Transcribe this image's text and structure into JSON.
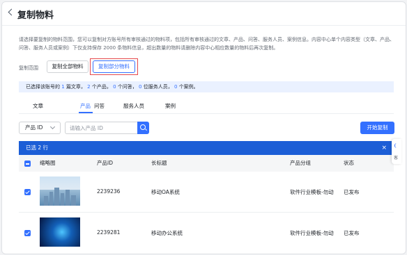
{
  "header": {
    "title": "复制物料"
  },
  "description": "请选择要复制的物料范围，您可以复制对方账号所有审核通过的物料项，包括所有审核通过的文章、产品、问答、服务人员、案例信息。内容中心单个内容类型（文章、产品、问答、服务人员或案例）下仅支持保存 2000 条物料信息，超出数量的物料请删除内容中心相应数量的物料后再次复制。",
  "range": {
    "label": "复制范围",
    "all_label": "复制全部物料",
    "part_label": "复制部分物料"
  },
  "summary": {
    "prefix": "已选择该账号的",
    "articles": "1",
    "articles_unit": "篇文章，",
    "products": "2",
    "products_unit": "个产品，",
    "qa": "0",
    "qa_unit": "个问答，",
    "staff": "0",
    "staff_unit": "位服务人员，",
    "cases": "0",
    "cases_unit": "个案例。"
  },
  "tabs": [
    {
      "label": "文章",
      "active": false
    },
    {
      "label": "产品",
      "active": true
    },
    {
      "label": "问答",
      "active": false
    },
    {
      "label": "服务人员",
      "active": false
    },
    {
      "label": "案例",
      "active": false
    }
  ],
  "filter": {
    "select_value": "产品 ID",
    "search_placeholder": "请输入产品 ID",
    "start_label": "开始复制"
  },
  "selection_bar": {
    "text": "已选 2 行",
    "close": "×"
  },
  "table": {
    "columns": [
      "缩略图",
      "产品ID",
      "长标题",
      "产品分组",
      "状态"
    ],
    "rows": [
      {
        "id": "2239236",
        "title": "移动OA系统",
        "group": "软件行业模板-勿动",
        "status": "已发布",
        "checked": true,
        "thumb": "city"
      },
      {
        "id": "2239281",
        "title": "移动办公系统",
        "group": "软件行业模板-勿动",
        "status": "已发布",
        "checked": true,
        "thumb": "tech"
      }
    ]
  },
  "side_tab": {
    "label": "客"
  },
  "colors": {
    "accent": "#3370ff",
    "selection_bar": "#1c5ed6",
    "highlight": "#e5474b"
  }
}
